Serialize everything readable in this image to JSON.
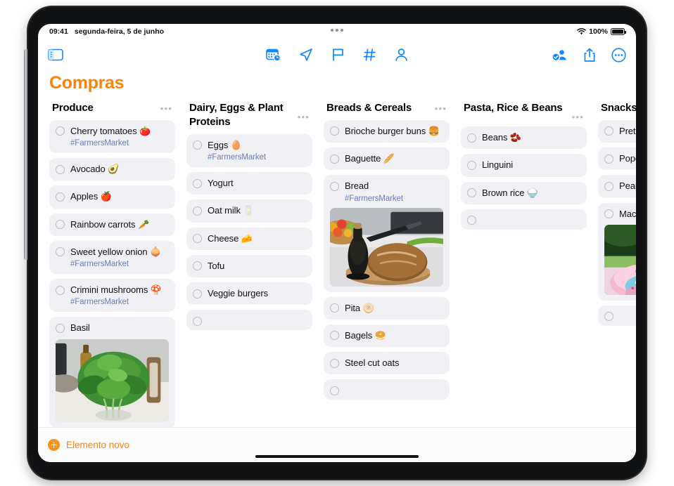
{
  "status_bar": {
    "time": "09:41",
    "date": "segunda-feira, 5 de junho",
    "battery_text": "100%",
    "wifi_icon": "wifi-icon",
    "battery_icon": "battery-icon",
    "multitask_icon": "multitask-dots-icon"
  },
  "toolbar": {
    "sidebar_toggle_icon": "sidebar-toggle-icon",
    "center_icons": [
      {
        "name": "calendar-clock-icon"
      },
      {
        "name": "location-arrow-icon"
      },
      {
        "name": "flag-icon"
      },
      {
        "name": "hashtag-icon"
      },
      {
        "name": "person-icon"
      }
    ],
    "right_icons": [
      {
        "name": "share-participants-icon"
      },
      {
        "name": "share-icon"
      },
      {
        "name": "more-ellipsis-icon"
      }
    ]
  },
  "page_title": "Compras",
  "accent_color": "#f5850c",
  "tag_color": "#6a7fb5",
  "board": {
    "columns": [
      {
        "title": "Produce",
        "menu_icon": "column-menu-icon",
        "items": [
          {
            "text": "Cherry tomatoes 🍅",
            "tag": "#FarmersMarket"
          },
          {
            "text": "Avocado 🥑"
          },
          {
            "text": "Apples 🍎"
          },
          {
            "text": "Rainbow carrots 🥕"
          },
          {
            "text": "Sweet yellow onion 🧅",
            "tag": "#FarmersMarket"
          },
          {
            "text": "Crimini mushrooms 🍄",
            "tag": "#FarmersMarket"
          },
          {
            "text": "Basil",
            "image": "basil"
          },
          {
            "text": "",
            "empty": true
          }
        ]
      },
      {
        "title": "Dairy, Eggs & Plant Proteins",
        "menu_icon": "column-menu-icon",
        "items": [
          {
            "text": "Eggs 🥚",
            "tag": "#FarmersMarket"
          },
          {
            "text": "Yogurt"
          },
          {
            "text": "Oat milk 🥛"
          },
          {
            "text": "Cheese 🧀"
          },
          {
            "text": "Tofu"
          },
          {
            "text": "Veggie burgers"
          },
          {
            "text": "",
            "empty": true
          }
        ]
      },
      {
        "title": "Breads & Cereals",
        "menu_icon": "column-menu-icon",
        "items": [
          {
            "text": "Brioche burger buns 🍔"
          },
          {
            "text": "Baguette 🥖"
          },
          {
            "text": "Bread",
            "tag": "#FarmersMarket",
            "image": "bread"
          },
          {
            "text": "Pita 🫓"
          },
          {
            "text": "Bagels 🥯"
          },
          {
            "text": "Steel cut oats"
          },
          {
            "text": "",
            "empty": true
          }
        ]
      },
      {
        "title": "Pasta, Rice & Beans",
        "menu_icon": "column-menu-icon",
        "items": [
          {
            "text": "Beans 🫘"
          },
          {
            "text": "Linguini"
          },
          {
            "text": "Brown rice 🍚"
          },
          {
            "text": "",
            "empty": true
          }
        ]
      },
      {
        "title": "Snacks & Candy",
        "menu_icon": "column-menu-icon",
        "items": [
          {
            "text": "Pretzels 🥨"
          },
          {
            "text": "Popcorn 🍿"
          },
          {
            "text": "Peanuts 🥜"
          },
          {
            "text": "Macarons",
            "image": "macaron"
          },
          {
            "text": "",
            "empty": true
          }
        ]
      }
    ]
  },
  "bottom_bar": {
    "new_item_label": "Elemento novo",
    "plus_icon": "plus-circle-icon"
  }
}
